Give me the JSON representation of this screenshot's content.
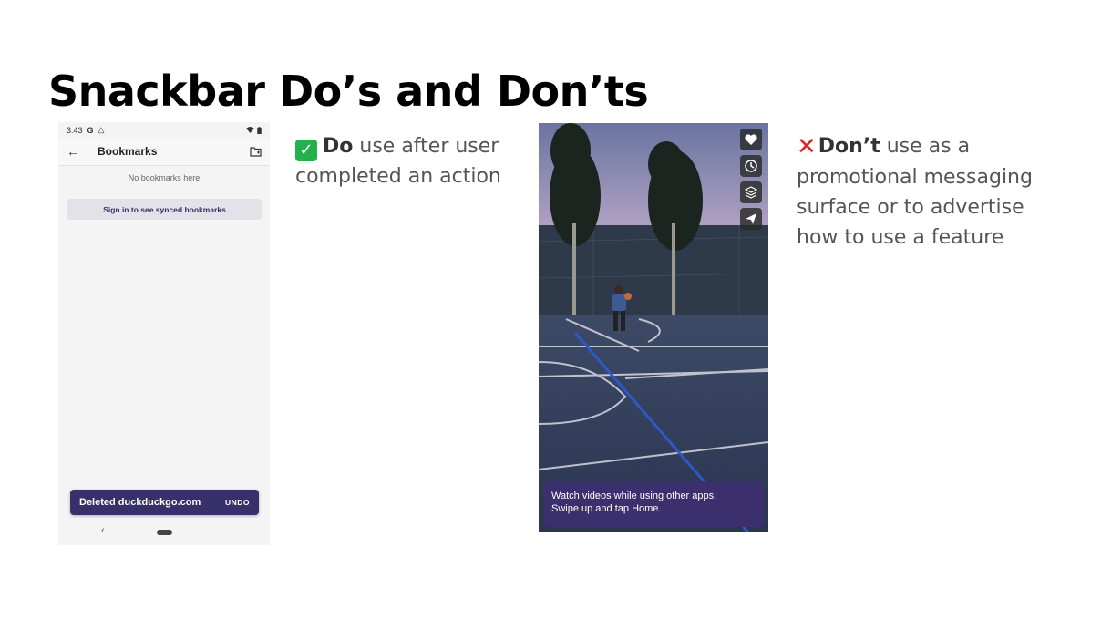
{
  "slide": {
    "title": "Snackbar Do’s and Don’ts"
  },
  "phone": {
    "status": {
      "time": "3:43",
      "g_icon": "G"
    },
    "appbar": {
      "title": "Bookmarks"
    },
    "empty_message": "No bookmarks here",
    "signin_button": "Sign in to see synced bookmarks",
    "snackbar": {
      "message": "Deleted duckduckgo.com",
      "action": "UNDO"
    },
    "icons": [
      "back-arrow-icon",
      "folder-icon",
      "wifi-icon",
      "battery-icon"
    ]
  },
  "do_text": {
    "lead": "Do",
    "rest": " use after user completed an action"
  },
  "dont_text": {
    "lead": "Don’t",
    "rest": " use as a promotional messaging surface or to advertise how to use a feature"
  },
  "video": {
    "promo_line1": "Watch videos while using other apps.",
    "promo_line2": "Swipe up and tap Home.",
    "side_icons": [
      "heart-icon",
      "clock-icon",
      "layers-icon",
      "send-icon"
    ]
  },
  "colors": {
    "snackbar_bg": "#37306b",
    "promo_bg": "#3c2f6d",
    "check_green": "#22b14c",
    "cross_red": "#e02020"
  }
}
